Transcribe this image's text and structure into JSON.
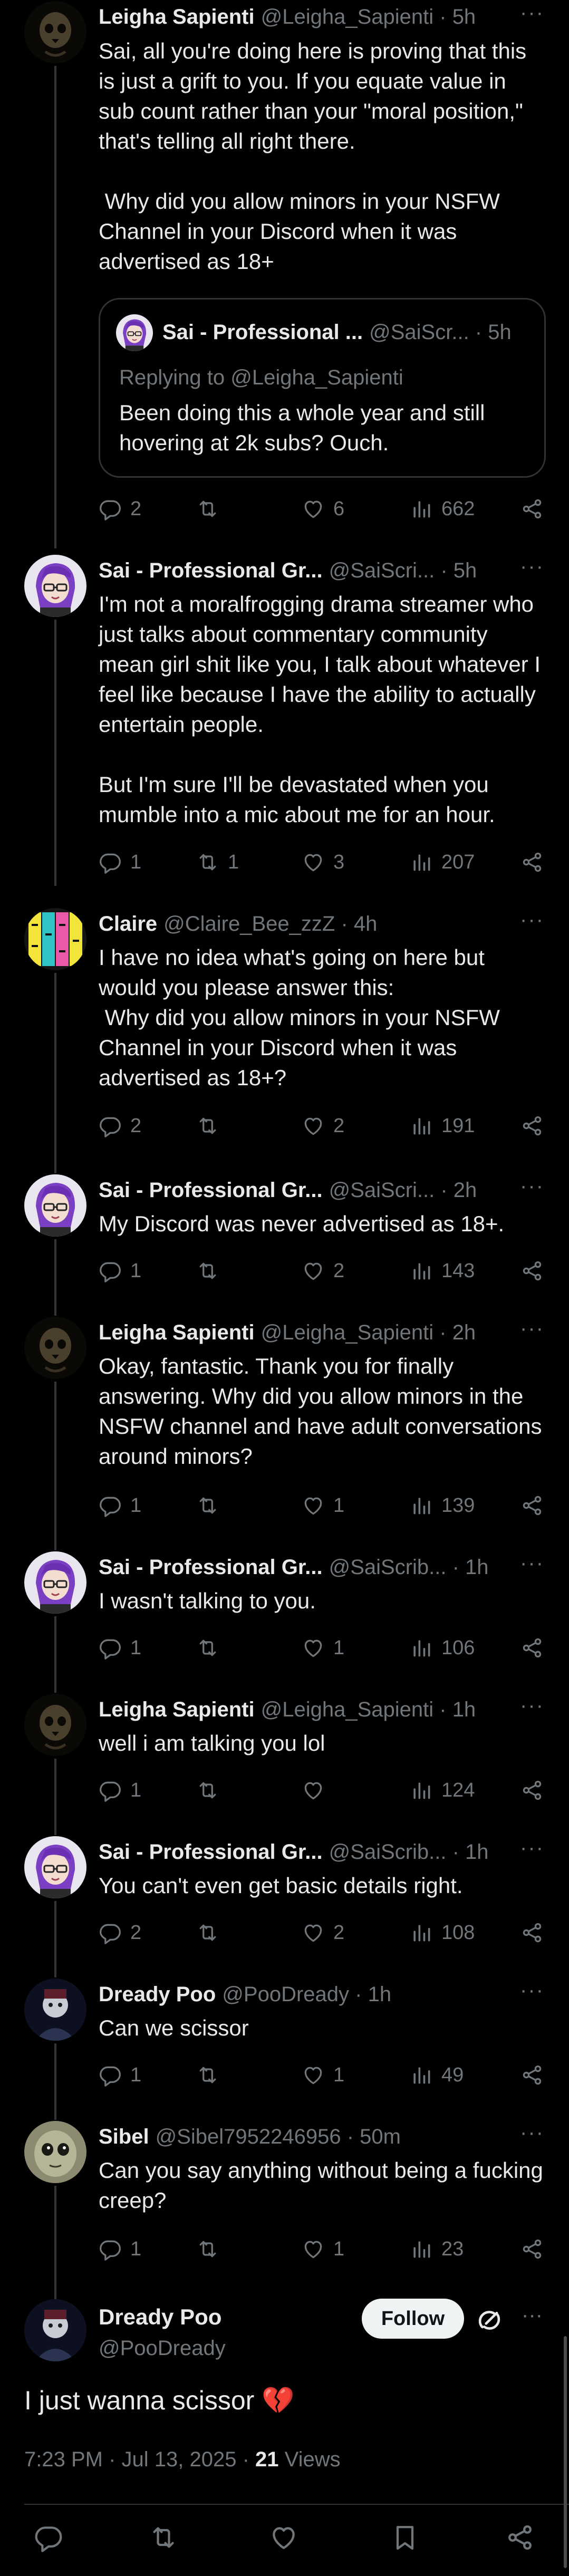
{
  "thread": [
    {
      "name": "Leigha Sapienti",
      "handle": "@Leigha_Sapienti",
      "time": "5h",
      "text": "Sai, all you're doing here is proving that this is just a grift to you. If you equate value in sub count rather than your \"moral position,\" that's telling all right there.\n\n Why did you allow minors in your NSFW Channel in your Discord when it was advertised as 18+",
      "quote": {
        "name": "Sai - Professional ...",
        "handle": "@SaiScr...",
        "time": "5h",
        "replying_to": "Replying to @Leigha_Sapienti",
        "text": "Been doing this a whole year and still hovering at 2k subs? Ouch."
      },
      "replies": "2",
      "retweets": "",
      "likes": "6",
      "views": "662"
    },
    {
      "name": "Sai - Professional Gr...",
      "handle": "@SaiScri...",
      "time": "5h",
      "text": "I'm not a moralfrogging drama streamer who just talks about commentary community mean girl shit like you, I talk about whatever I feel like because I have the ability to actually entertain people.\n\nBut I'm sure I'll be devastated when you mumble into a mic about me for an hour.",
      "replies": "1",
      "retweets": "1",
      "likes": "3",
      "views": "207"
    },
    {
      "name": "Claire",
      "handle": "@Claire_Bee_zzZ",
      "time": "4h",
      "text": "I have no idea what's going on here but would you please answer this:\n Why did you allow minors in your NSFW Channel in your Discord when it was advertised as 18+?",
      "replies": "2",
      "retweets": "",
      "likes": "2",
      "views": "191"
    },
    {
      "name": "Sai - Professional Gr...",
      "handle": "@SaiScri...",
      "time": "2h",
      "text": "My Discord was never advertised as 18+.",
      "replies": "1",
      "retweets": "",
      "likes": "2",
      "views": "143"
    },
    {
      "name": "Leigha Sapienti",
      "handle": "@Leigha_Sapienti",
      "time": "2h",
      "text": "Okay, fantastic. Thank you for finally answering. Why did you allow minors in the NSFW channel and have adult conversations around minors?",
      "replies": "1",
      "retweets": "",
      "likes": "1",
      "views": "139"
    },
    {
      "name": "Sai - Professional Gr...",
      "handle": "@SaiScrib...",
      "time": "1h",
      "text": "I wasn't talking to you.",
      "replies": "1",
      "retweets": "",
      "likes": "1",
      "views": "106"
    },
    {
      "name": "Leigha Sapienti",
      "handle": "@Leigha_Sapienti",
      "time": "1h",
      "text": "well i am talking you lol",
      "replies": "1",
      "retweets": "",
      "likes": "",
      "views": "124"
    },
    {
      "name": "Sai - Professional Gr...",
      "handle": "@SaiScrib...",
      "time": "1h",
      "text": "You can't even get basic details right.",
      "replies": "2",
      "retweets": "",
      "likes": "2",
      "views": "108"
    },
    {
      "name": "Dready Poo",
      "handle": "@PooDready",
      "time": "1h",
      "text": "Can we scissor",
      "replies": "1",
      "retweets": "",
      "likes": "1",
      "views": "49"
    },
    {
      "name": "Sibel",
      "handle": "@Sibel7952246956",
      "time": "50m",
      "text": "Can you say anything without being a fucking creep?",
      "replies": "1",
      "retweets": "",
      "likes": "1",
      "views": "23"
    }
  ],
  "main_post": {
    "name": "Dready Poo",
    "handle": "@PooDready",
    "follow_label": "Follow",
    "text": "I just wanna scissor",
    "emoji": "💔",
    "timestamp": "7:23 PM · Jul 13, 2025 · ",
    "views_count": "21",
    "views_label": " Views"
  },
  "colors": {
    "background": "#000000",
    "text": "#e7e9ea",
    "secondary": "#71767b",
    "border": "#2f3336",
    "follow_bg": "#eff3f4"
  },
  "icons": [
    "reply-icon",
    "retweet-icon",
    "like-icon",
    "views-icon",
    "share-icon",
    "bookmark-icon",
    "grok-icon",
    "more-icon"
  ]
}
